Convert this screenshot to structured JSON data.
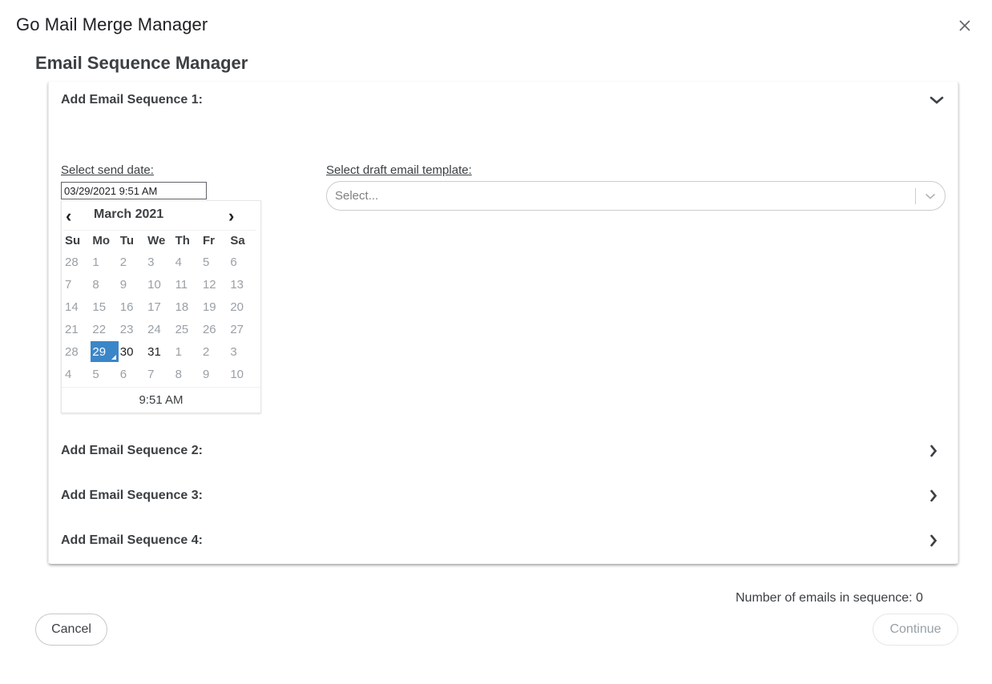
{
  "dialog": {
    "title": "Go Mail Merge Manager",
    "close_icon": "close-icon"
  },
  "page": {
    "title": "Email Sequence Manager"
  },
  "sequences": [
    {
      "label": "Add Email Sequence 1:",
      "expanded": true
    },
    {
      "label": "Add Email Sequence 2:",
      "expanded": false
    },
    {
      "label": "Add Email Sequence 3:",
      "expanded": false
    },
    {
      "label": "Add Email Sequence 4:",
      "expanded": false
    }
  ],
  "sequence1": {
    "date_label": "Select send date:",
    "date_value": "03/29/2021 9:51 AM",
    "template_label": "Select draft email template:",
    "template_placeholder": "Select..."
  },
  "datepicker": {
    "prev": "‹",
    "next": "›",
    "month": "March 2021",
    "weekdays": [
      "Su",
      "Mo",
      "Tu",
      "We",
      "Th",
      "Fr",
      "Sa"
    ],
    "weeks": [
      [
        "28",
        "1",
        "2",
        "3",
        "4",
        "5",
        "6"
      ],
      [
        "7",
        "8",
        "9",
        "10",
        "11",
        "12",
        "13"
      ],
      [
        "14",
        "15",
        "16",
        "17",
        "18",
        "19",
        "20"
      ],
      [
        "21",
        "22",
        "23",
        "24",
        "25",
        "26",
        "27"
      ],
      [
        "28",
        "29",
        "30",
        "31",
        "1",
        "2",
        "3"
      ],
      [
        "4",
        "5",
        "6",
        "7",
        "8",
        "9",
        "10"
      ]
    ],
    "time": "9:51 AM"
  },
  "footer": {
    "count_text": "Number of emails in sequence: 0",
    "cancel_label": "Cancel",
    "continue_label": "Continue"
  },
  "colors": {
    "selected_day": "#3b86c8",
    "text": "#3c4043",
    "muted": "#9aa0a6"
  }
}
